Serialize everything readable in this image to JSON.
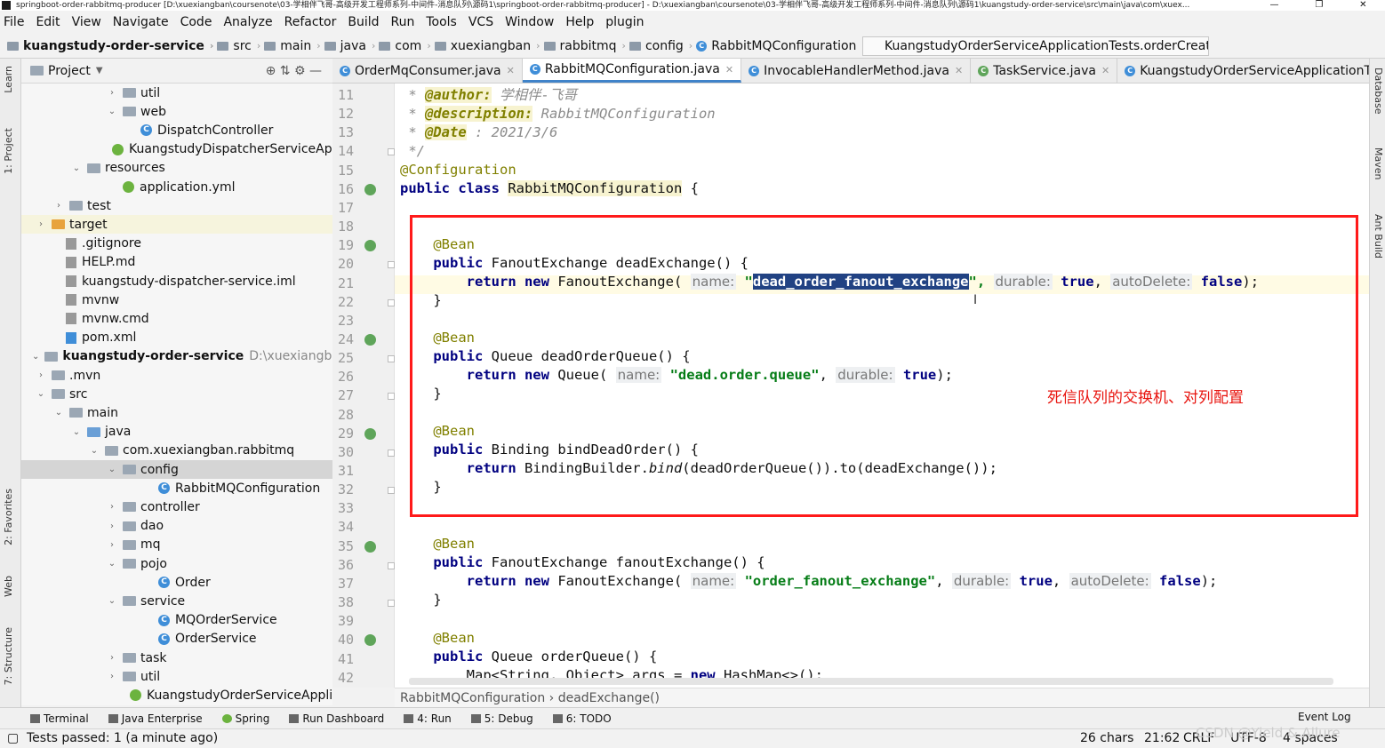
{
  "window": {
    "title": "springboot-order-rabbitmq-producer [D:\\xuexiangban\\coursenote\\03-学相伴飞哥-高级开发工程师系列-中间件-消息队列\\源码1\\springboot-order-rabbitmq-producer] - D:\\xuexiangban\\coursenote\\03-学相伴飞哥-高级开发工程师系列-中间件-消息队列\\源码1\\kuangstudy-order-service\\src\\main\\java\\com\\xuex..."
  },
  "menu": [
    "File",
    "Edit",
    "View",
    "Navigate",
    "Code",
    "Analyze",
    "Refactor",
    "Build",
    "Run",
    "Tools",
    "VCS",
    "Window",
    "Help",
    "plugin"
  ],
  "breadcrumbs": [
    "kuangstudy-order-service",
    "src",
    "main",
    "java",
    "com",
    "xuexiangban",
    "rabbitmq",
    "config",
    "RabbitMQConfiguration"
  ],
  "run_config": "KuangstudyOrderServiceApplicationTests.orderCreateMQ",
  "left_tool_tabs": [
    "Learn",
    "1: Project",
    "2: Favorites",
    "Web",
    "7: Structure"
  ],
  "right_tool_tabs": [
    "Database",
    "Maven",
    "Ant Build"
  ],
  "project_panel": {
    "title": "Project"
  },
  "tree": [
    {
      "label": "util",
      "arrow": "›",
      "type": "folder"
    },
    {
      "label": "web",
      "arrow": "⌄",
      "type": "folder"
    },
    {
      "label": "DispatchController",
      "arrow": "",
      "type": "class"
    },
    {
      "label": "KuangstudyDispatcherServiceApplic",
      "arrow": "",
      "type": "spring"
    },
    {
      "label": "resources",
      "arrow": "⌄",
      "type": "folder"
    },
    {
      "label": "application.yml",
      "arrow": "",
      "type": "spring"
    },
    {
      "label": "test",
      "arrow": "›",
      "type": "folder"
    },
    {
      "label": "target",
      "arrow": "›",
      "type": "folder-orange"
    },
    {
      "label": ".gitignore",
      "arrow": "",
      "type": "file"
    },
    {
      "label": "HELP.md",
      "arrow": "",
      "type": "file"
    },
    {
      "label": "kuangstudy-dispatcher-service.iml",
      "arrow": "",
      "type": "file"
    },
    {
      "label": "mvnw",
      "arrow": "",
      "type": "file"
    },
    {
      "label": "mvnw.cmd",
      "arrow": "",
      "type": "file"
    },
    {
      "label": "pom.xml",
      "arrow": "",
      "type": "maven"
    },
    {
      "label": "kuangstudy-order-service",
      "path": "D:\\xuexiangban\\course",
      "arrow": "⌄",
      "type": "module"
    },
    {
      "label": ".mvn",
      "arrow": "›",
      "type": "folder"
    },
    {
      "label": "src",
      "arrow": "⌄",
      "type": "folder"
    },
    {
      "label": "main",
      "arrow": "⌄",
      "type": "folder"
    },
    {
      "label": "java",
      "arrow": "⌄",
      "type": "folder-blue"
    },
    {
      "label": "com.xuexiangban.rabbitmq",
      "arrow": "⌄",
      "type": "folder"
    },
    {
      "label": "config",
      "arrow": "⌄",
      "type": "folder"
    },
    {
      "label": "RabbitMQConfiguration",
      "arrow": "",
      "type": "class"
    },
    {
      "label": "controller",
      "arrow": "›",
      "type": "folder"
    },
    {
      "label": "dao",
      "arrow": "›",
      "type": "folder"
    },
    {
      "label": "mq",
      "arrow": "›",
      "type": "folder"
    },
    {
      "label": "pojo",
      "arrow": "⌄",
      "type": "folder"
    },
    {
      "label": "Order",
      "arrow": "",
      "type": "class"
    },
    {
      "label": "service",
      "arrow": "⌄",
      "type": "folder"
    },
    {
      "label": "MQOrderService",
      "arrow": "",
      "type": "class"
    },
    {
      "label": "OrderService",
      "arrow": "",
      "type": "class"
    },
    {
      "label": "task",
      "arrow": "›",
      "type": "folder"
    },
    {
      "label": "util",
      "arrow": "›",
      "type": "folder"
    },
    {
      "label": "KuangstudyOrderServiceApplication",
      "arrow": "",
      "type": "spring"
    }
  ],
  "tabs": [
    "OrderMqConsumer.java",
    "RabbitMQConfiguration.java",
    "InvocableHandlerMethod.java",
    "TaskService.java",
    "KuangstudyOrderServiceApplicationTests.java"
  ],
  "active_tab": "RabbitMQConfiguration.java",
  "line_numbers": [
    "11",
    "12",
    "13",
    "14",
    "15",
    "16",
    "17",
    "18",
    "19",
    "20",
    "21",
    "22",
    "23",
    "24",
    "25",
    "26",
    "27",
    "28",
    "29",
    "30",
    "31",
    "32",
    "33",
    "34",
    "35",
    "36",
    "37",
    "38",
    "39",
    "40",
    "41",
    "42"
  ],
  "code": {
    "l11": [
      " * ",
      "@author:",
      " 学相伴-飞哥"
    ],
    "l12": [
      " * ",
      "@description:",
      " RabbitMQConfiguration"
    ],
    "l13": [
      " * ",
      "@Date",
      " : 2021/3/6"
    ],
    "l14": " */",
    "l15": "@Configuration",
    "l16": [
      "public class ",
      "RabbitMQConfiguration",
      " {"
    ],
    "l19": "    @Bean",
    "l20": [
      "    ",
      "public",
      " FanoutExchange deadExchange() {"
    ],
    "l21": [
      "        ",
      "return new",
      " FanoutExchange( ",
      "name:",
      " \"",
      "dead_order_fanout_exchange",
      "\", ",
      "durable:",
      " ",
      "true",
      ", ",
      "autoDelete:",
      " ",
      "false",
      ");"
    ],
    "l22": "    }",
    "l24": "    @Bean",
    "l25": [
      "    ",
      "public",
      " Queue deadOrderQueue() {"
    ],
    "l26": [
      "        ",
      "return new",
      " Queue( ",
      "name:",
      " ",
      "\"dead.order.queue\"",
      ", ",
      "durable:",
      " ",
      "true",
      ");"
    ],
    "l27": "    }",
    "l29": "    @Bean",
    "l30": [
      "    ",
      "public",
      " Binding bindDeadOrder() {"
    ],
    "l31": [
      "        ",
      "return",
      " BindingBuilder.",
      "bind",
      "(deadOrderQueue()).to(deadExchange());"
    ],
    "l32": "    }",
    "l35": "    @Bean",
    "l36": [
      "    ",
      "public",
      " FanoutExchange fanoutExchange() {"
    ],
    "l37": [
      "        ",
      "return new",
      " FanoutExchange( ",
      "name:",
      " ",
      "\"order_fanout_exchange\"",
      ", ",
      "durable:",
      " ",
      "true",
      ", ",
      "autoDelete:",
      " ",
      "false",
      ");"
    ],
    "l38": "    }",
    "l40": "    @Bean",
    "l41": [
      "    ",
      "public",
      " Queue orderQueue() {"
    ],
    "l42": [
      "        Map<String, Object> args = ",
      "new",
      " HashMap<>();"
    ]
  },
  "annotation_text": "死信队列的交换机、对列配置",
  "editor_breadcrumb": [
    "RabbitMQConfiguration",
    "deadExchange()"
  ],
  "bottom_tools": [
    "Terminal",
    "Java Enterprise",
    "Spring",
    "Run Dashboard",
    "4: Run",
    "5: Debug",
    "6: TODO"
  ],
  "event_log": "Event Log",
  "status": {
    "left": "Tests passed: 1 (a minute ago)",
    "chars": "26 chars",
    "position": "21:62",
    "line_sep": "CRLF",
    "encoding": "UTF-8",
    "indent": "4 spaces",
    "watermark": "CSDN @Yield & Allure"
  },
  "colors": {
    "keyword": "#000080",
    "annotation": "#808000",
    "string": "#067d17",
    "red_box": "#ff1a1a",
    "annotation_text": "#e8140e",
    "selection": "#214283"
  }
}
